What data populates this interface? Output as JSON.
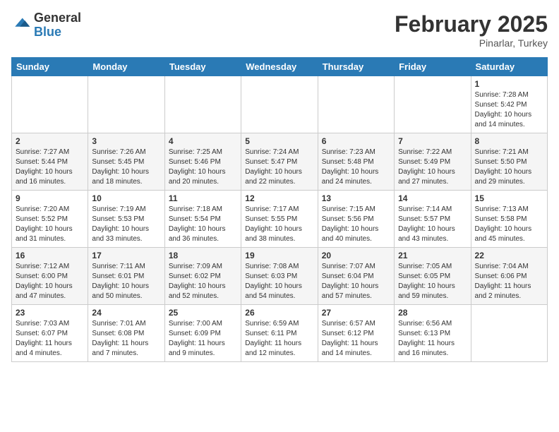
{
  "header": {
    "logo_general": "General",
    "logo_blue": "Blue",
    "month_year": "February 2025",
    "location": "Pinarlar, Turkey"
  },
  "days_of_week": [
    "Sunday",
    "Monday",
    "Tuesday",
    "Wednesday",
    "Thursday",
    "Friday",
    "Saturday"
  ],
  "weeks": [
    [
      {
        "day": "",
        "info": ""
      },
      {
        "day": "",
        "info": ""
      },
      {
        "day": "",
        "info": ""
      },
      {
        "day": "",
        "info": ""
      },
      {
        "day": "",
        "info": ""
      },
      {
        "day": "",
        "info": ""
      },
      {
        "day": "1",
        "info": "Sunrise: 7:28 AM\nSunset: 5:42 PM\nDaylight: 10 hours\nand 14 minutes."
      }
    ],
    [
      {
        "day": "2",
        "info": "Sunrise: 7:27 AM\nSunset: 5:44 PM\nDaylight: 10 hours\nand 16 minutes."
      },
      {
        "day": "3",
        "info": "Sunrise: 7:26 AM\nSunset: 5:45 PM\nDaylight: 10 hours\nand 18 minutes."
      },
      {
        "day": "4",
        "info": "Sunrise: 7:25 AM\nSunset: 5:46 PM\nDaylight: 10 hours\nand 20 minutes."
      },
      {
        "day": "5",
        "info": "Sunrise: 7:24 AM\nSunset: 5:47 PM\nDaylight: 10 hours\nand 22 minutes."
      },
      {
        "day": "6",
        "info": "Sunrise: 7:23 AM\nSunset: 5:48 PM\nDaylight: 10 hours\nand 24 minutes."
      },
      {
        "day": "7",
        "info": "Sunrise: 7:22 AM\nSunset: 5:49 PM\nDaylight: 10 hours\nand 27 minutes."
      },
      {
        "day": "8",
        "info": "Sunrise: 7:21 AM\nSunset: 5:50 PM\nDaylight: 10 hours\nand 29 minutes."
      }
    ],
    [
      {
        "day": "9",
        "info": "Sunrise: 7:20 AM\nSunset: 5:52 PM\nDaylight: 10 hours\nand 31 minutes."
      },
      {
        "day": "10",
        "info": "Sunrise: 7:19 AM\nSunset: 5:53 PM\nDaylight: 10 hours\nand 33 minutes."
      },
      {
        "day": "11",
        "info": "Sunrise: 7:18 AM\nSunset: 5:54 PM\nDaylight: 10 hours\nand 36 minutes."
      },
      {
        "day": "12",
        "info": "Sunrise: 7:17 AM\nSunset: 5:55 PM\nDaylight: 10 hours\nand 38 minutes."
      },
      {
        "day": "13",
        "info": "Sunrise: 7:15 AM\nSunset: 5:56 PM\nDaylight: 10 hours\nand 40 minutes."
      },
      {
        "day": "14",
        "info": "Sunrise: 7:14 AM\nSunset: 5:57 PM\nDaylight: 10 hours\nand 43 minutes."
      },
      {
        "day": "15",
        "info": "Sunrise: 7:13 AM\nSunset: 5:58 PM\nDaylight: 10 hours\nand 45 minutes."
      }
    ],
    [
      {
        "day": "16",
        "info": "Sunrise: 7:12 AM\nSunset: 6:00 PM\nDaylight: 10 hours\nand 47 minutes."
      },
      {
        "day": "17",
        "info": "Sunrise: 7:11 AM\nSunset: 6:01 PM\nDaylight: 10 hours\nand 50 minutes."
      },
      {
        "day": "18",
        "info": "Sunrise: 7:09 AM\nSunset: 6:02 PM\nDaylight: 10 hours\nand 52 minutes."
      },
      {
        "day": "19",
        "info": "Sunrise: 7:08 AM\nSunset: 6:03 PM\nDaylight: 10 hours\nand 54 minutes."
      },
      {
        "day": "20",
        "info": "Sunrise: 7:07 AM\nSunset: 6:04 PM\nDaylight: 10 hours\nand 57 minutes."
      },
      {
        "day": "21",
        "info": "Sunrise: 7:05 AM\nSunset: 6:05 PM\nDaylight: 10 hours\nand 59 minutes."
      },
      {
        "day": "22",
        "info": "Sunrise: 7:04 AM\nSunset: 6:06 PM\nDaylight: 11 hours\nand 2 minutes."
      }
    ],
    [
      {
        "day": "23",
        "info": "Sunrise: 7:03 AM\nSunset: 6:07 PM\nDaylight: 11 hours\nand 4 minutes."
      },
      {
        "day": "24",
        "info": "Sunrise: 7:01 AM\nSunset: 6:08 PM\nDaylight: 11 hours\nand 7 minutes."
      },
      {
        "day": "25",
        "info": "Sunrise: 7:00 AM\nSunset: 6:09 PM\nDaylight: 11 hours\nand 9 minutes."
      },
      {
        "day": "26",
        "info": "Sunrise: 6:59 AM\nSunset: 6:11 PM\nDaylight: 11 hours\nand 12 minutes."
      },
      {
        "day": "27",
        "info": "Sunrise: 6:57 AM\nSunset: 6:12 PM\nDaylight: 11 hours\nand 14 minutes."
      },
      {
        "day": "28",
        "info": "Sunrise: 6:56 AM\nSunset: 6:13 PM\nDaylight: 11 hours\nand 16 minutes."
      },
      {
        "day": "",
        "info": ""
      }
    ]
  ]
}
